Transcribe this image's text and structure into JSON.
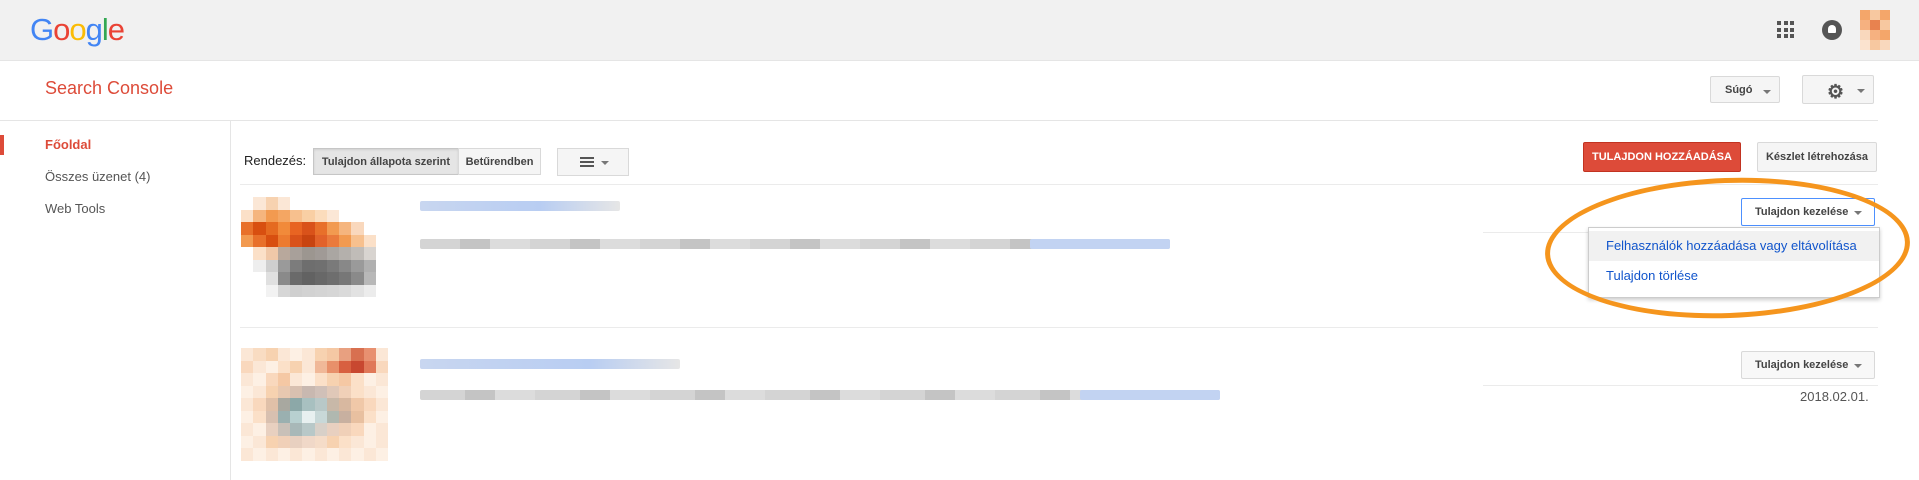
{
  "google_bar": {
    "logo": "Google",
    "apps_icon": "apps-grid-icon",
    "notification_icon": "bell-icon",
    "avatar_colors": [
      "#f4a66a",
      "#f7c8a0",
      "#f4a66a",
      "#f6b180",
      "#e8824f",
      "#f7c8a0",
      "#f9d8bd",
      "#f6b180",
      "#f4a66a",
      "#fbe3cf",
      "#f7c8a0",
      "#f9d8bd"
    ]
  },
  "header": {
    "product_title": "Search Console",
    "help_label": "Súgó",
    "settings_icon": "gear-icon"
  },
  "sidebar": {
    "items": [
      {
        "label": "Főoldal",
        "active": true
      },
      {
        "label": "Összes üzenet (4)",
        "active": false
      },
      {
        "label": "Web Tools",
        "active": false
      }
    ]
  },
  "toolbar": {
    "sort_label": "Rendezés:",
    "sort_options": [
      "Tulajdon állapota szerint",
      "Betűrendben"
    ],
    "view_icon": "list-view-icon",
    "add_property_label": "TULAJDON HOZZÁADÁSA",
    "create_set_label": "Készlet létrehozása"
  },
  "properties": [
    {
      "manage_label": "Tulajdon kezelése",
      "menu_open": true,
      "menu_items": [
        "Felhasználók hozzáadása vagy eltávolítása",
        "Tulajdon törlése"
      ],
      "thumb_colors": [
        "#fff",
        "#fbe7d6",
        "#f7d2b0",
        "#fbe7d6",
        "#fff",
        "#fff",
        "#fff",
        "#fff",
        "#fff",
        "#fff",
        "#fff",
        "#fff",
        "#fbe0c8",
        "#f5b57e",
        "#f29a50",
        "#f4a663",
        "#f7c08e",
        "#f9cfa4",
        "#fbdcbc",
        "#fbe7d6",
        "#fff",
        "#fff",
        "#fff",
        "#fff",
        "#e8702a",
        "#d84f10",
        "#e56a20",
        "#f18a3a",
        "#e86422",
        "#d9521a",
        "#e8702a",
        "#f29a50",
        "#f5b57e",
        "#f9d8bd",
        "#fff",
        "#fff",
        "#f29a50",
        "#e8702a",
        "#d84f10",
        "#ec7b30",
        "#d9521a",
        "#c84410",
        "#e2622a",
        "#ea7a3c",
        "#f29a50",
        "#f7c08e",
        "#fbe0c8",
        "#fff",
        "#fff",
        "#fbe0c8",
        "#f0c8a8",
        "#b8a89c",
        "#a8a09a",
        "#9c9690",
        "#a09a96",
        "#aaa6a2",
        "#b4b0ac",
        "#c0bcb8",
        "#d8d4d0",
        "#fff",
        "#fff",
        "#eeeeee",
        "#cfcfcf",
        "#9a9a9a",
        "#7c7c7c",
        "#6e6e6e",
        "#707070",
        "#7a7a7a",
        "#888",
        "#9a9a9a",
        "#b0b0b0",
        "#fff",
        "#fff",
        "#fff",
        "#e0e0e0",
        "#8a8a8a",
        "#6a6a6a",
        "#626262",
        "#686868",
        "#6e6e6e",
        "#777",
        "#8a8a8a",
        "#b8b8b8",
        "#fff",
        "#fff",
        "#fff",
        "#f2f2f2",
        "#d6d6d6",
        "#cfcfcf",
        "#d2d2d2",
        "#d4d4d4",
        "#d6d6d6",
        "#dadada",
        "#e2e2e2",
        "#ececec",
        "#fff",
        "#fff",
        "#fff",
        "#fff",
        "#fff",
        "#fff",
        "#fff",
        "#fff",
        "#fff",
        "#fff",
        "#fff",
        "#fff",
        "#fff"
      ]
    },
    {
      "manage_label": "Tulajdon kezelése",
      "menu_open": false,
      "date": "2018.02.01.",
      "thumb_colors": [
        "#fbe7d6",
        "#f9dcc2",
        "#f7d2b0",
        "#fbe7d6",
        "#fdf0e4",
        "#fbe7d6",
        "#f7d2b0",
        "#f5c8a4",
        "#e8a080",
        "#d87050",
        "#e89070",
        "#fbe7d6",
        "#f9d8bd",
        "#fbe7d6",
        "#fdf0e4",
        "#fbe0c8",
        "#f7d2b0",
        "#fbe7d6",
        "#f0b898",
        "#e8906a",
        "#d86040",
        "#c84830",
        "#e07858",
        "#f9d8bd",
        "#fbe7d6",
        "#fdf0e4",
        "#f9d8bd",
        "#f5c8a4",
        "#fbe7d6",
        "#fdf0e4",
        "#fbe0c8",
        "#f7d2b0",
        "#f5c8a4",
        "#fbe0c8",
        "#fdf0e4",
        "#fbe7d6",
        "#fdf0e4",
        "#fbe7d6",
        "#f7d2b0",
        "#e8c8b0",
        "#d8c0b0",
        "#c8b8b0",
        "#d0c0b8",
        "#e0c8b8",
        "#f0d0b8",
        "#fbe0c8",
        "#fbe7d6",
        "#fdf0e4",
        "#fbe7d6",
        "#f9d8bd",
        "#e0c0a8",
        "#a8a8a0",
        "#8ca8a8",
        "#a8c0c0",
        "#b8c8c8",
        "#c8b8a8",
        "#d8b8a0",
        "#f0c8a8",
        "#f9d8bd",
        "#fbe7d6",
        "#fdf0e4",
        "#fbe0c8",
        "#d8c0b0",
        "#9ab0b0",
        "#b8d0d0",
        "#e8f0f0",
        "#c8d8d8",
        "#b0b8b0",
        "#c8b0a0",
        "#e8c0a0",
        "#fbe0c8",
        "#fdf0e4",
        "#fbe7d6",
        "#fdf0e4",
        "#e8d0c0",
        "#c8c0b8",
        "#a8b8b8",
        "#b8c8c8",
        "#d8d0c8",
        "#e8d0c0",
        "#f0d0b8",
        "#f9d8bd",
        "#fdf0e4",
        "#fbe7d6",
        "#fdf0e4",
        "#fbe7d6",
        "#f7d2b0",
        "#f0d0b8",
        "#e8d0c0",
        "#f0d8c8",
        "#f5dcc8",
        "#f7d2b0",
        "#fbe0c8",
        "#fbe7d6",
        "#fdf0e4",
        "#fbe7d6",
        "#fbe7d6",
        "#fdf0e4",
        "#fbe7d6",
        "#fdf0e4",
        "#fbe7d6",
        "#fdf0e4",
        "#fbe7d6",
        "#fdf0e4",
        "#fbe7d6",
        "#fdf0e4",
        "#fbe7d6",
        "#fdf0e4"
      ]
    }
  ],
  "annotation_color": "#f5951d"
}
